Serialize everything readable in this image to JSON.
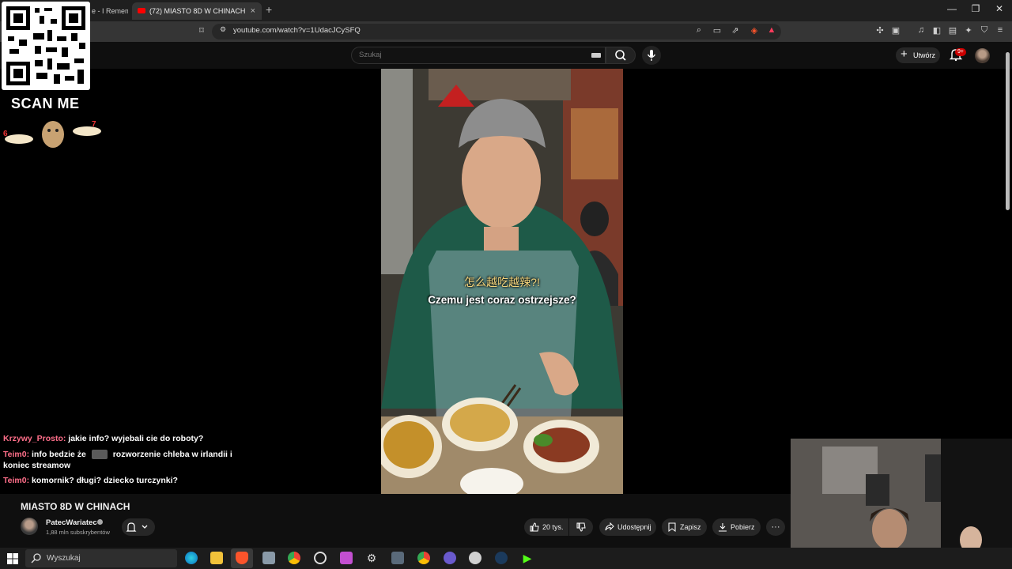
{
  "browser": {
    "tabs": [
      {
        "label": "e - I Remem"
      },
      {
        "label": "(72) MIASTO 8D W CHINACH"
      }
    ],
    "new_tab": "+",
    "close_tab": "×",
    "window_controls": {
      "minimize": "—",
      "restore": "❐",
      "close": "✕"
    },
    "url": "youtube.com/watch?v=1UdacJCySFQ"
  },
  "youtube": {
    "search_placeholder": "Szukaj",
    "create_label": "Utwórz",
    "notification_badge": "9+"
  },
  "overlay": {
    "scan_label": "SCAN ME"
  },
  "video": {
    "subtitle_cn": "怎么越吃越辣?!",
    "subtitle_pl": "Czemu jest coraz ostrzejsze?"
  },
  "chat": [
    {
      "user": "Krzywy_Prosto:",
      "message": "jakie info? wyjebali cie do roboty?"
    },
    {
      "user": "Teim0:",
      "message_before": "info bedzie że",
      "message_after": "rozworzenie chleba w irlandii i koniec streamow"
    },
    {
      "user": "Teim0:",
      "message": "komornik? długi? dziecko turczynki?"
    }
  ],
  "watch": {
    "title": "MIASTO 8D W CHINACH",
    "channel_name": "PatecWariatec",
    "subscribers": "1,88 mln subskrybentów",
    "like_count": "20 tys.",
    "share_label": "Udostępnij",
    "save_label": "Zapisz",
    "download_label": "Pobierz",
    "more_label": "···"
  },
  "taskbar": {
    "search_placeholder": "Wyszukaj"
  },
  "colors": {
    "youtube_red": "#ff0000",
    "chat_user": "#ff6f8a",
    "subtitle_cn": "#f2d37b"
  }
}
